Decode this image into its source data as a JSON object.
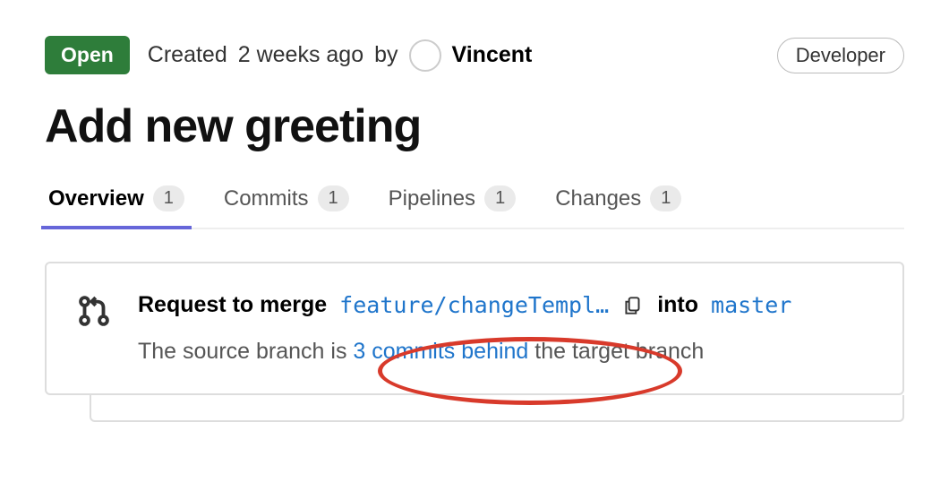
{
  "header": {
    "status": "Open",
    "created_prefix": "Created",
    "created_time": "2 weeks ago",
    "created_by": "by",
    "author": "Vincent",
    "role": "Developer"
  },
  "title": "Add new greeting",
  "tabs": [
    {
      "label": "Overview",
      "count": "1",
      "active": true
    },
    {
      "label": "Commits",
      "count": "1",
      "active": false
    },
    {
      "label": "Pipelines",
      "count": "1",
      "active": false
    },
    {
      "label": "Changes",
      "count": "1",
      "active": false
    }
  ],
  "merge": {
    "request_label": "Request to merge",
    "source_branch": "feature/changeTempl…",
    "into_label": "into",
    "target_branch": "master",
    "behind_prefix": "The source branch is ",
    "behind_link": "3 commits behind",
    "behind_suffix": " the target branch"
  }
}
